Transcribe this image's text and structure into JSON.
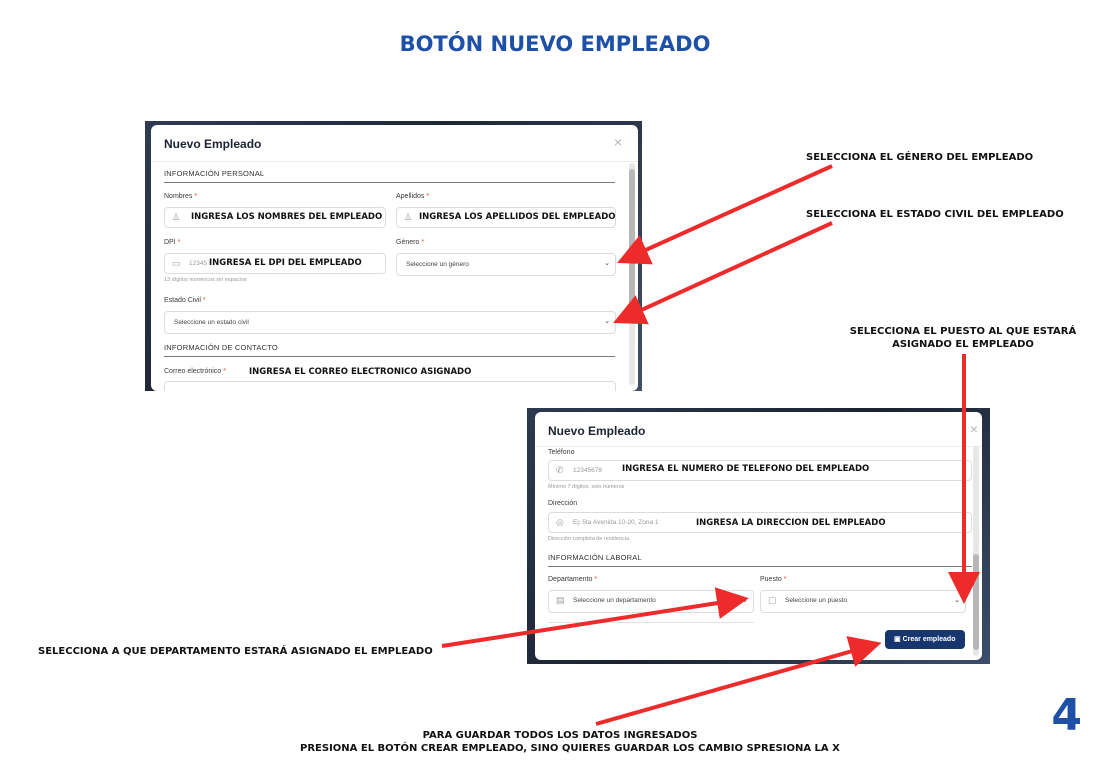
{
  "page": {
    "title": "BOTÓN NUEVO EMPLEADO",
    "number": "4"
  },
  "annotations": {
    "gender": "SELECCIONA EL GÉNERO DEL EMPLEADO",
    "civil_status": "SELECCIONA EL ESTADO CIVIL DEL EMPLEADO",
    "position_line1": "SELECCIONA EL PUESTO AL QUE ESTARÁ",
    "position_line2": "ASIGNADO EL EMPLEADO",
    "department": "SELECCIONA A QUE DEPARTAMENTO ESTARÁ ASIGNADO EL EMPLEADO",
    "save_line1": "PARA GUARDAR TODOS LOS DATOS INGRESADOS",
    "save_line2": "PRESIONA EL BOTÓN CREAR EMPLEADO, SINO QUIERES GUARDAR LOS CAMBIO SPRESIONA LA X"
  },
  "screen1": {
    "modal_title": "Nuevo Empleado",
    "close": "×",
    "section_personal": "INFORMACIÓN PERSONAL",
    "nombres_label": "Nombres",
    "nombres_overlay": "INGRESA LOS NOMBRES DEL EMPLEADO",
    "apellidos_label": "Apellidos",
    "apellidos_overlay": "INGRESA LOS APELLIDOS DEL EMPLEADO",
    "dpi_label": "DPI",
    "dpi_placeholder": "12345",
    "dpi_overlay": "INGRESA EL DPI DEL EMPLEADO",
    "dpi_help": "13 dígitos numéricos sin espacios",
    "genero_label": "Género",
    "genero_value": "Seleccione un género",
    "estado_label": "Estado Civil",
    "estado_value": "Seleccione un estado civil",
    "section_contact": "INFORMACIÓN DE CONTACTO",
    "correo_label": "Correo electrónico",
    "correo_overlay": "INGRESA EL CORREO ELECTRONICO ASIGNADO",
    "required_mark": "*"
  },
  "screen2": {
    "modal_title": "Nuevo Empleado",
    "close": "×",
    "telefono_label": "Teléfono",
    "telefono_placeholder": "12345678",
    "telefono_overlay": "INGRESA EL NUMERO DE TELEFONO DEL EMPLEADO",
    "telefono_help": "Mínimo 7 dígitos, solo números",
    "direccion_label": "Dirección",
    "direccion_placeholder": "Ej: 5ta Avenida 10-20, Zona 1",
    "direccion_overlay": "INGRESA LA DIRECCION DEL EMPLEADO",
    "direccion_help": "Dirección completa de residencia",
    "section_laboral": "INFORMACIÓN LABORAL",
    "departamento_label": "Departamento",
    "departamento_value": "Seleccione un departamento",
    "puesto_label": "Puesto",
    "puesto_value": "Seleccione un puesto",
    "create_button": "Crear empleado",
    "required_mark": "*"
  },
  "colors": {
    "title_blue": "#1e50a8",
    "arrow_red": "#ee2b2b",
    "button_navy": "#17366f"
  }
}
